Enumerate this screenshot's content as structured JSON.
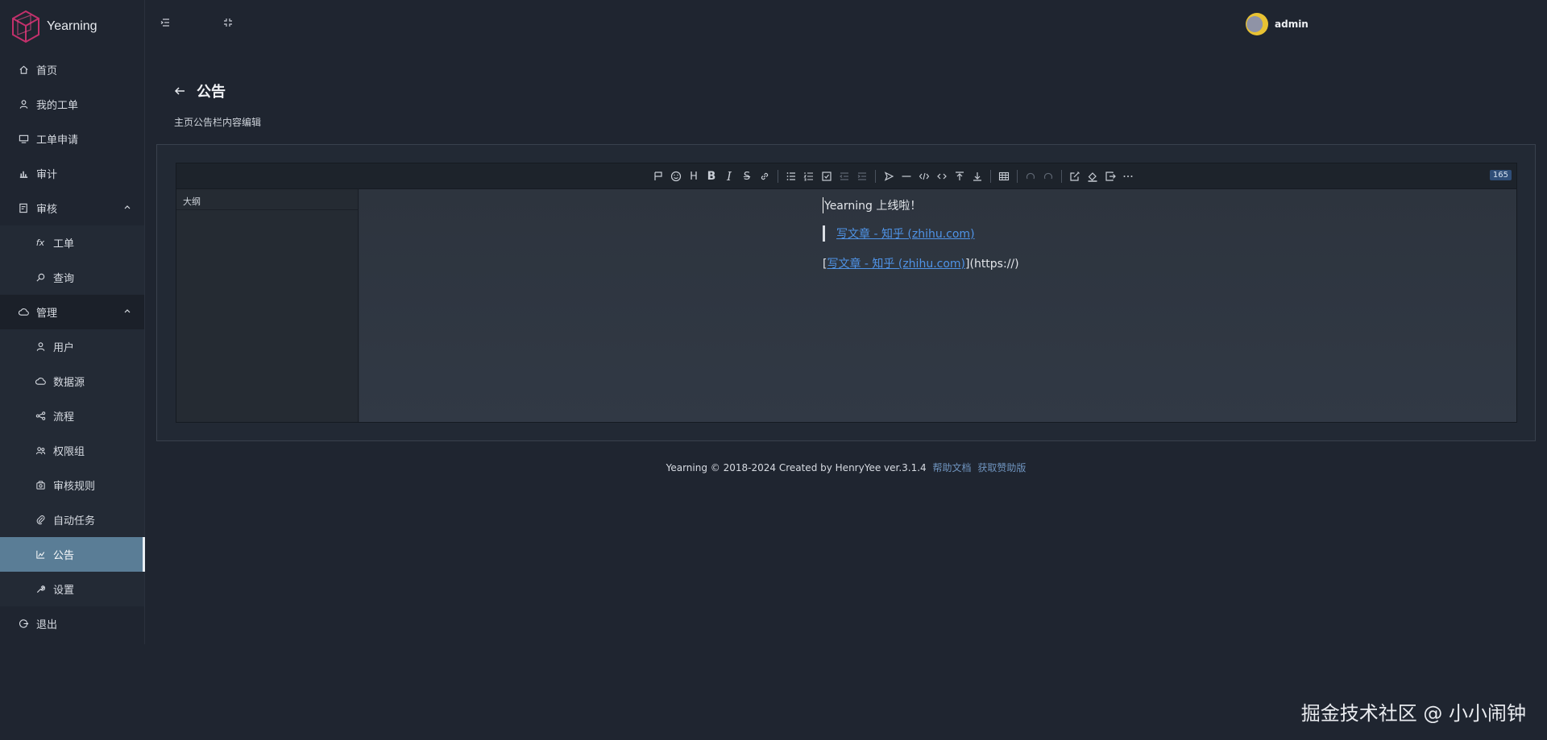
{
  "app": {
    "name": "Yearning",
    "accent": "#c2306b"
  },
  "header": {
    "username": "admin"
  },
  "sidebar": {
    "items": [
      {
        "label": "首页",
        "icon": "home-icon"
      },
      {
        "label": "我的工单",
        "icon": "user-icon"
      },
      {
        "label": "工单申请",
        "icon": "monitor-icon"
      },
      {
        "label": "审计",
        "icon": "chart-icon"
      },
      {
        "label": "审核",
        "icon": "audit-icon"
      },
      {
        "label": "工单",
        "icon": "fx-icon"
      },
      {
        "label": "查询",
        "icon": "search-icon"
      },
      {
        "label": "管理",
        "icon": "cloud-icon"
      },
      {
        "label": "用户",
        "icon": "user-icon"
      },
      {
        "label": "数据源",
        "icon": "cloud-icon"
      },
      {
        "label": "流程",
        "icon": "share-icon"
      },
      {
        "label": "权限组",
        "icon": "group-icon"
      },
      {
        "label": "审核规则",
        "icon": "rule-icon"
      },
      {
        "label": "自动任务",
        "icon": "paperclip-icon"
      },
      {
        "label": "公告",
        "icon": "chart-line-icon"
      },
      {
        "label": "设置",
        "icon": "wrench-icon"
      },
      {
        "label": "退出",
        "icon": "logout-icon"
      }
    ]
  },
  "page": {
    "title": "公告",
    "subtitle": "主页公告栏内容编辑"
  },
  "editor": {
    "outline_title": "大纲",
    "char_count": "165",
    "line1": "Yearning 上线啦！",
    "quote_link": "写文章 - 知乎 (zhihu.com)",
    "line3_open": "[",
    "line3_link": "写文章 - 知乎 (zhihu.com)",
    "line3_close": "](https://)"
  },
  "footer": {
    "text": "Yearning © 2018-2024 Created by HenryYee ver.3.1.4",
    "link1": "帮助文档",
    "link2": "获取赞助版"
  },
  "watermark": "掘金技术社区 @ 小小闹钟"
}
